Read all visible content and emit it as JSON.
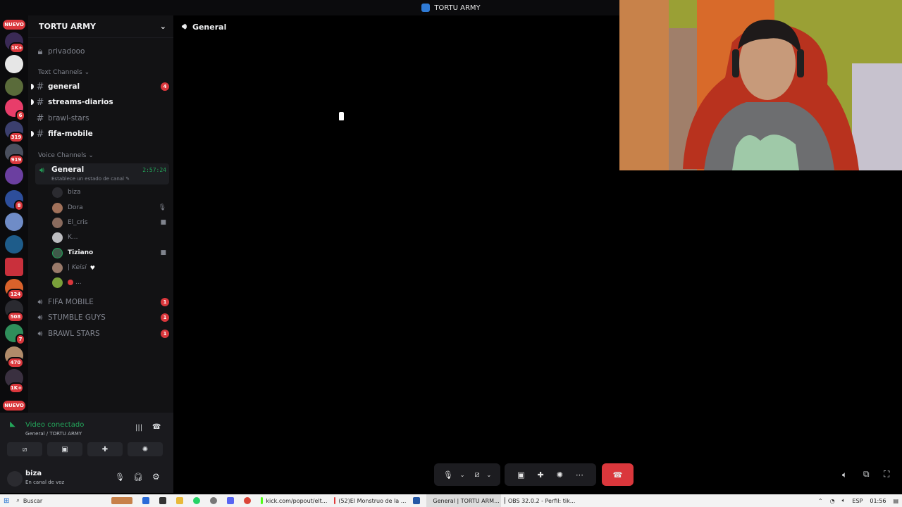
{
  "window": {
    "title": "TORTU ARMY"
  },
  "rail": {
    "top_badge": "NUEVO",
    "bottom_badge": "NUEVO",
    "badges": [
      "1K+",
      "6",
      "319",
      "919",
      "8",
      "124",
      "508",
      "7",
      "470",
      "1K+"
    ]
  },
  "server": {
    "name": "TORTU ARMY"
  },
  "channels": {
    "private": "privadooo",
    "text_category": "Text Channels",
    "text": [
      {
        "name": "general",
        "count": "4"
      },
      {
        "name": "streams-diarios"
      },
      {
        "name": "brawl-stars"
      },
      {
        "name": "fifa-mobile"
      }
    ],
    "voice_category": "Voice Channels",
    "active_voice": {
      "name": "General",
      "timer": "2:57:24",
      "status": "Establece un estado de canal"
    },
    "members": [
      "biza",
      "Dora",
      "El_cris",
      "K...",
      "Tiziano",
      "| Keisi",
      "..."
    ],
    "other_voice": [
      {
        "name": "FIFA MOBILE",
        "count": "1"
      },
      {
        "name": "STUMBLE GUYS",
        "count": "1"
      },
      {
        "name": "BRAWL STARS",
        "count": "1"
      }
    ]
  },
  "connection": {
    "status": "Video conectado",
    "location": "General / TORTU ARMY"
  },
  "user": {
    "name": "biza",
    "status": "En canal de voz"
  },
  "stage": {
    "channel": "General"
  },
  "taskbar": {
    "search": "Buscar",
    "items": [
      "kick.com/popout/elt...",
      "(52)El Monstruo de la ...",
      "General | TORTU ARM...",
      "OBS 32.0.2 - Perfil: tik..."
    ],
    "lang": "ESP",
    "time": "01:56"
  },
  "colors": {
    "accent_red": "#da373c",
    "connected_green": "#23a55a",
    "hangup": "#da373c"
  }
}
